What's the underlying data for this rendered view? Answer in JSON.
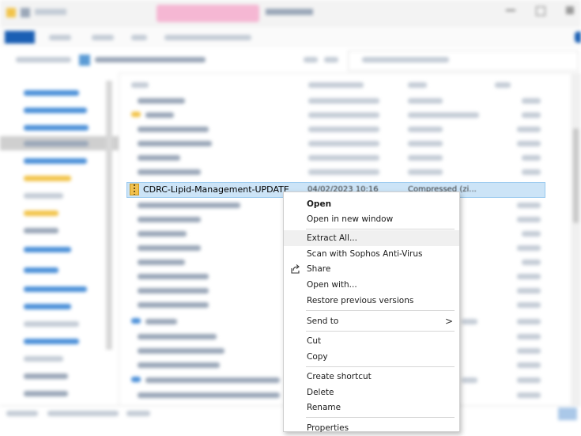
{
  "file": {
    "name": "CDRC-Lipid-Management-UPDATE",
    "date": "04/02/2023 10:16",
    "type": "Compressed (zi..."
  },
  "context_menu": {
    "items": [
      {
        "label": "Open",
        "bold": true
      },
      {
        "label": "Open in new window"
      },
      {
        "label": "Extract All...",
        "highlighted": true
      },
      {
        "label": "Scan with Sophos Anti-Virus"
      },
      {
        "label": "Share",
        "icon": "share-icon"
      },
      {
        "label": "Open with..."
      },
      {
        "label": "Restore previous versions"
      },
      {
        "label": "Send to",
        "submenu": true
      },
      {
        "label": "Cut"
      },
      {
        "label": "Copy"
      },
      {
        "label": "Create shortcut"
      },
      {
        "label": "Delete"
      },
      {
        "label": "Rename"
      },
      {
        "label": "Properties"
      }
    ],
    "submenu_arrow": ">"
  },
  "colors": {
    "selection": "#cce4f7",
    "menu_hover": "#f0f0f0",
    "folder": "#f2c44a",
    "accent": "#0067c0"
  }
}
